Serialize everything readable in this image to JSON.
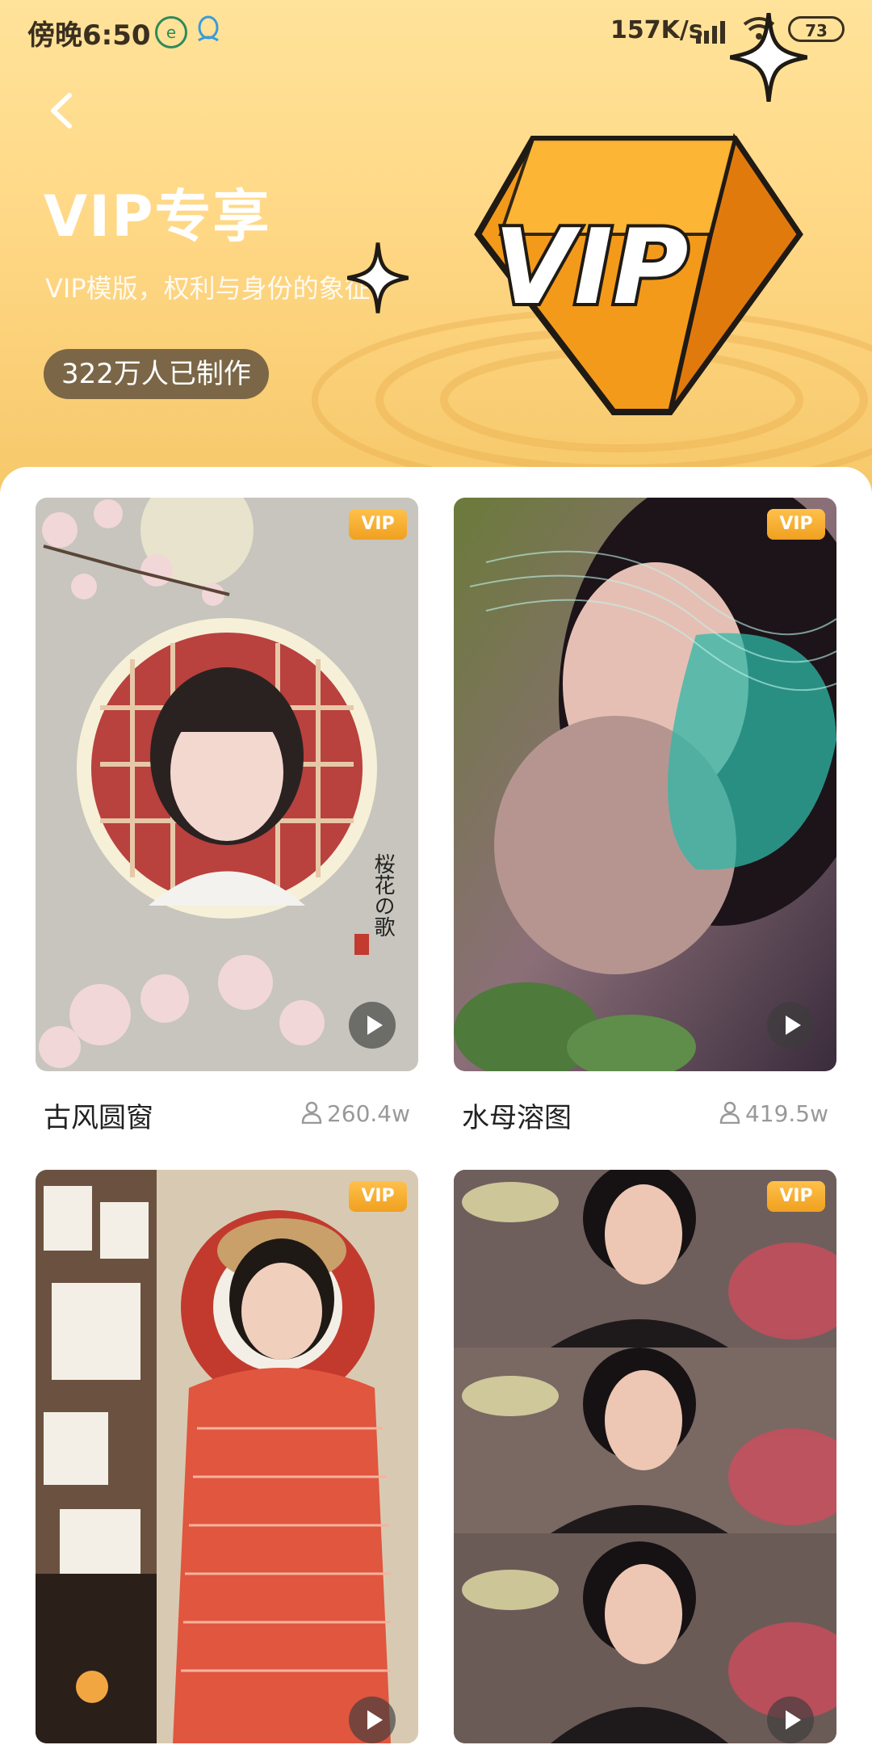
{
  "status_bar": {
    "time": "傍晚6:50",
    "speed": "157K/s",
    "battery": "73"
  },
  "header": {
    "title": "VIP专享",
    "subtitle": "VIP模版，权利与身份的象征",
    "made_count": "322万人已制作",
    "emblem_text": "VIP"
  },
  "templates": [
    {
      "name": "古风圆窗",
      "usage": "260.4w",
      "badge": "VIP",
      "vertical_text": "桜花の歌"
    },
    {
      "name": "水母溶图",
      "usage": "419.5w",
      "badge": "VIP"
    },
    {
      "name": "",
      "usage": "",
      "badge": "VIP"
    },
    {
      "name": "",
      "usage": "",
      "badge": "VIP"
    }
  ],
  "colors": {
    "header_top": "#ffe39a",
    "header_bottom": "#f6c86a",
    "badge": "#f0a020",
    "pill": "#7b6747"
  },
  "icons": [
    "back-icon",
    "sparkle-icon",
    "play-icon",
    "user-icon",
    "vip-diamond-icon"
  ]
}
